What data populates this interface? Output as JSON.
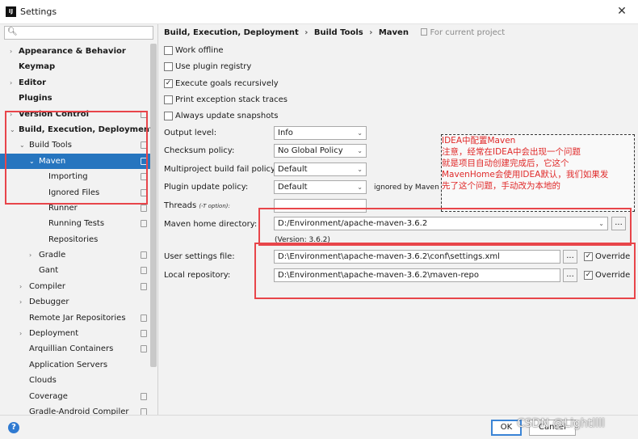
{
  "window": {
    "title": "Settings",
    "app_icon": "IJ"
  },
  "sidebar": {
    "search_placeholder": "",
    "items": [
      {
        "label": "Appearance & Behavior",
        "bold": true,
        "arrow": "›",
        "indent": 0,
        "copy": false
      },
      {
        "label": "Keymap",
        "bold": true,
        "arrow": "",
        "indent": 0,
        "copy": false
      },
      {
        "label": "Editor",
        "bold": true,
        "arrow": "›",
        "indent": 0,
        "copy": false
      },
      {
        "label": "Plugins",
        "bold": true,
        "arrow": "",
        "indent": 0,
        "copy": false
      },
      {
        "label": "Version Control",
        "bold": true,
        "arrow": "›",
        "indent": 0,
        "copy": true
      },
      {
        "label": "Build, Execution, Deployment",
        "bold": true,
        "arrow": "⌄",
        "indent": 0,
        "copy": false
      },
      {
        "label": "Build Tools",
        "bold": false,
        "arrow": "⌄",
        "indent": 1,
        "copy": true
      },
      {
        "label": "Maven",
        "bold": false,
        "arrow": "⌄",
        "indent": 2,
        "copy": true,
        "selected": true
      },
      {
        "label": "Importing",
        "bold": false,
        "arrow": "",
        "indent": 3,
        "copy": true
      },
      {
        "label": "Ignored Files",
        "bold": false,
        "arrow": "",
        "indent": 3,
        "copy": true
      },
      {
        "label": "Runner",
        "bold": false,
        "arrow": "",
        "indent": 3,
        "copy": true
      },
      {
        "label": "Running Tests",
        "bold": false,
        "arrow": "",
        "indent": 3,
        "copy": true
      },
      {
        "label": "Repositories",
        "bold": false,
        "arrow": "",
        "indent": 3,
        "copy": false
      },
      {
        "label": "Gradle",
        "bold": false,
        "arrow": "›",
        "indent": 2,
        "copy": true
      },
      {
        "label": "Gant",
        "bold": false,
        "arrow": "",
        "indent": 2,
        "copy": true
      },
      {
        "label": "Compiler",
        "bold": false,
        "arrow": "›",
        "indent": 1,
        "copy": true
      },
      {
        "label": "Debugger",
        "bold": false,
        "arrow": "›",
        "indent": 1,
        "copy": false
      },
      {
        "label": "Remote Jar Repositories",
        "bold": false,
        "arrow": "",
        "indent": 1,
        "copy": true
      },
      {
        "label": "Deployment",
        "bold": false,
        "arrow": "›",
        "indent": 1,
        "copy": true
      },
      {
        "label": "Arquillian Containers",
        "bold": false,
        "arrow": "",
        "indent": 1,
        "copy": true
      },
      {
        "label": "Application Servers",
        "bold": false,
        "arrow": "",
        "indent": 1,
        "copy": false
      },
      {
        "label": "Clouds",
        "bold": false,
        "arrow": "",
        "indent": 1,
        "copy": false
      },
      {
        "label": "Coverage",
        "bold": false,
        "arrow": "",
        "indent": 1,
        "copy": true
      },
      {
        "label": "Gradle-Android Compiler",
        "bold": false,
        "arrow": "",
        "indent": 1,
        "copy": true
      }
    ]
  },
  "breadcrumb": {
    "parts": [
      "Build, Execution, Deployment",
      "Build Tools",
      "Maven"
    ],
    "separator": "›",
    "project_note": "For current project"
  },
  "checkboxes": [
    {
      "label": "Work offline",
      "checked": false
    },
    {
      "label": "Use plugin registry",
      "checked": false
    },
    {
      "label": "Execute goals recursively",
      "checked": true
    },
    {
      "label": "Print exception stack traces",
      "checked": false
    },
    {
      "label": "Always update snapshots",
      "checked": false
    }
  ],
  "form": {
    "output_level": {
      "label": "Output level:",
      "value": "Info"
    },
    "checksum_policy": {
      "label": "Checksum policy:",
      "value": "No Global Policy"
    },
    "multiproject_fail_policy": {
      "label": "Multiproject build fail policy:",
      "value": "Default"
    },
    "plugin_update_policy": {
      "label": "Plugin update policy:",
      "value": "Default",
      "note": "ignored by Maven 3+"
    },
    "threads": {
      "label": "Threads",
      "hint": "(-T option):",
      "value": ""
    },
    "maven_home": {
      "label": "Maven home directory:",
      "value": "D:/Environment/apache-maven-3.6.2",
      "version": "(Version: 3.6.2)"
    },
    "user_settings": {
      "label": "User settings file:",
      "value": "D:\\Environment\\apache-maven-3.6.2\\conf\\settings.xml",
      "override_label": "Override",
      "override": true
    },
    "local_repository": {
      "label": "Local repository:",
      "value": "D:\\Environment\\apache-maven-3.6.2\\maven-repo",
      "override_label": "Override",
      "override": true
    },
    "browse_label": "..."
  },
  "annotation": {
    "lines": [
      "IDEA中配置Maven",
      "注意，经常在IDEA中会出现一个问题",
      "就是项目自动创建完成后，它这个",
      "MavenHome会使用IDEA默认，我们如果发",
      "先了这个问题，手动改为本地的"
    ]
  },
  "footer": {
    "ok_label": "OK",
    "cancel_label": "Cancel",
    "help_label": "?",
    "watermark": "CSDN @Lightllll"
  },
  "colors": {
    "selection": "#2675bf",
    "highlight_box": "#e8454a",
    "annotation_text": "#e02a2a",
    "help": "#2f7ad1"
  }
}
